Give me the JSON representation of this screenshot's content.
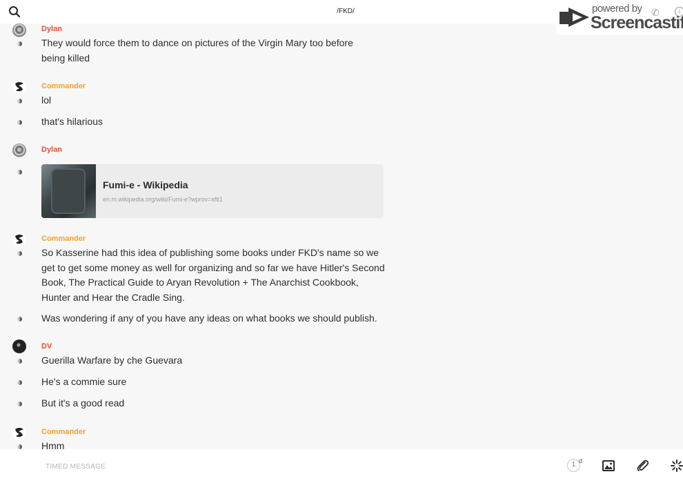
{
  "header": {
    "channel_title": "/FKD/"
  },
  "watermark": {
    "powered_by": "powered by",
    "brand": "Screencastify"
  },
  "messages": [
    {
      "author": "Dylan",
      "lines": [
        "They would force them to dance on pictures of the Virgin Mary too before being killed"
      ]
    },
    {
      "author": "Commander",
      "lines": [
        "lol",
        "that's hilarious"
      ]
    },
    {
      "author": "Dylan",
      "link": {
        "title": "Fumi-e - Wikipedia",
        "url": "en.m.wikipedia.org/wiki/Fumi-e?wprov=sfti1"
      }
    },
    {
      "author": "Commander",
      "lines": [
        "So Kasserine had this idea of publishing some books under FKD's name so we get to get some money as well for organizing and so far we have Hitler's Second Book, The Practical Guide to Aryan Revolution + The Anarchist Cookbook, Hunter and Hear the Cradle Sing.",
        "Was wondering if any of you have any ideas on what books we should publish."
      ]
    },
    {
      "author": "DV",
      "lines": [
        "Guerilla Warfare by che Guevara",
        "He's a commie sure",
        "But it's a good read"
      ]
    },
    {
      "author": "Commander",
      "lines": [
        "Hmm"
      ]
    }
  ],
  "composer": {
    "placeholder": "TIMED MESSAGE",
    "timer_value": "1",
    "timer_unit": "d"
  },
  "colors": {
    "author_red": "#e0523a",
    "author_orange": "#f0a030",
    "background": "#f7f7f7"
  },
  "icons": [
    "search-icon",
    "phone-icon",
    "info-icon",
    "image-icon",
    "paperclip-icon",
    "loading-icon"
  ]
}
